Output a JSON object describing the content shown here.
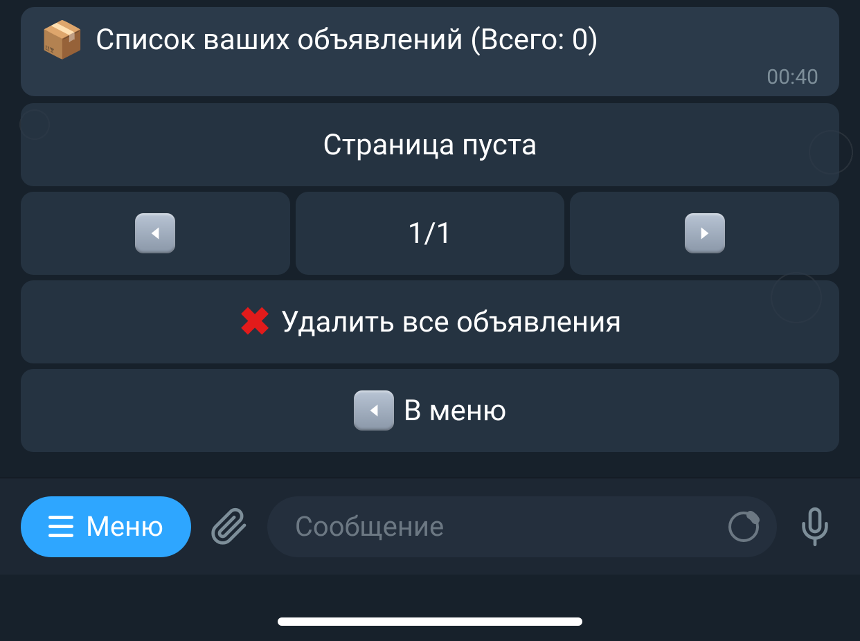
{
  "message": {
    "icon": "package-icon",
    "emoji": "📦",
    "text": "Список ваших объявлений (Всего: 0)",
    "time": "00:40"
  },
  "keyboard": {
    "empty_label": "Страница пуста",
    "prev_icon": "arrow-left-icon",
    "page_indicator": "1/1",
    "next_icon": "arrow-right-icon",
    "delete_all_icon": "cross-icon",
    "delete_all_label": "Удалить все объявления",
    "back_icon": "arrow-left-icon",
    "back_label": "В меню"
  },
  "input_bar": {
    "menu_label": "Меню",
    "placeholder": "Сообщение"
  },
  "icons": {
    "hamburger": "hamburger-icon",
    "attach": "paperclip-icon",
    "sticker": "sticker-icon",
    "mic": "microphone-icon"
  }
}
